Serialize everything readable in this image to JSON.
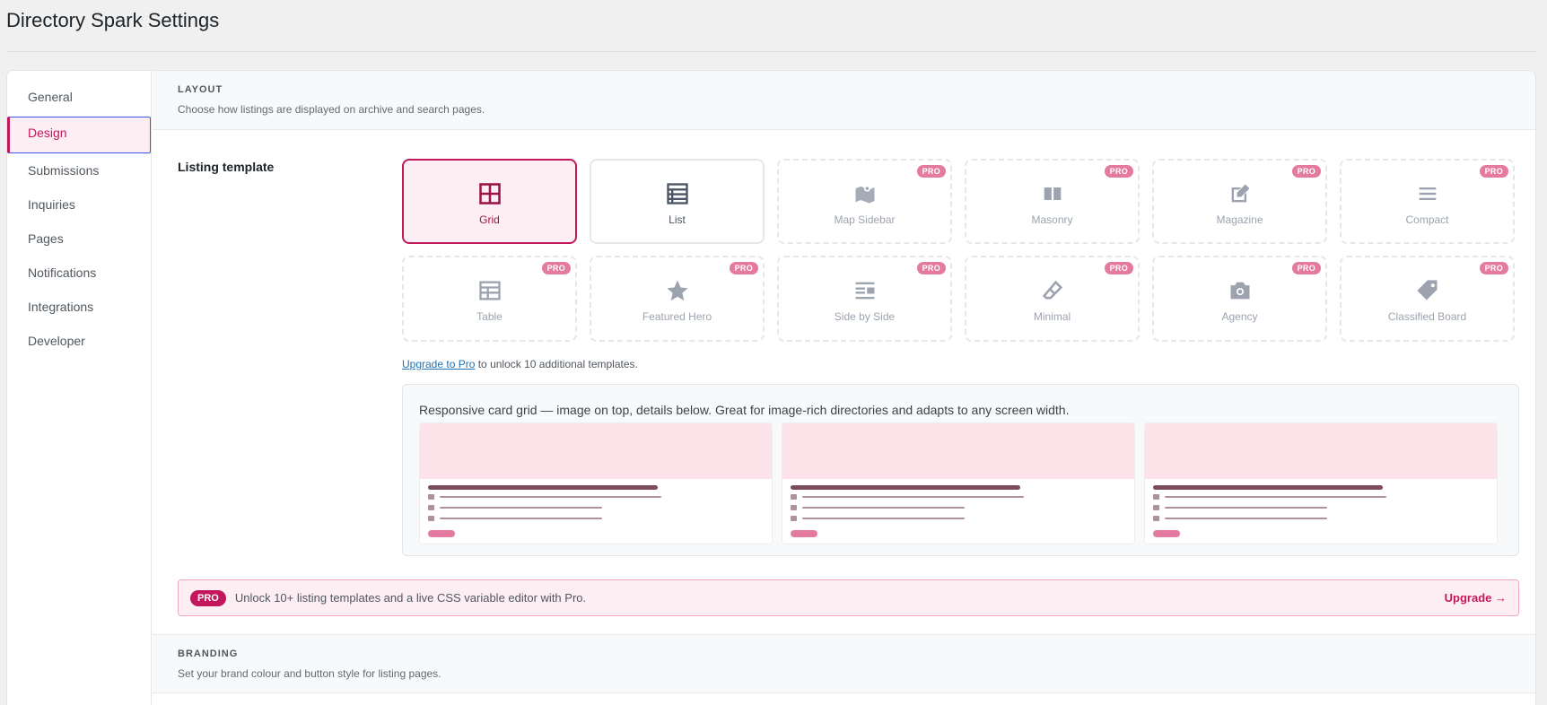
{
  "page": {
    "title": "Directory Spark Settings"
  },
  "sidebar": {
    "items": [
      {
        "label": "General",
        "active": false
      },
      {
        "label": "Design",
        "active": true
      },
      {
        "label": "Submissions",
        "active": false
      },
      {
        "label": "Inquiries",
        "active": false
      },
      {
        "label": "Pages",
        "active": false
      },
      {
        "label": "Notifications",
        "active": false
      },
      {
        "label": "Integrations",
        "active": false
      },
      {
        "label": "Developer",
        "active": false
      }
    ]
  },
  "layout": {
    "title": "LAYOUT",
    "desc": "Choose how listings are displayed on archive and search pages.",
    "listing_label": "Listing template",
    "templates": [
      {
        "label": "Grid",
        "icon": "grid-icon",
        "pro": false,
        "state": "selected"
      },
      {
        "label": "List",
        "icon": "list-icon",
        "pro": false,
        "state": "enabled"
      },
      {
        "label": "Map Sidebar",
        "icon": "map-icon",
        "pro": true,
        "state": "locked"
      },
      {
        "label": "Masonry",
        "icon": "columns-icon",
        "pro": true,
        "state": "locked"
      },
      {
        "label": "Magazine",
        "icon": "edit-icon",
        "pro": true,
        "state": "locked"
      },
      {
        "label": "Compact",
        "icon": "menu-icon",
        "pro": true,
        "state": "locked"
      },
      {
        "label": "Table",
        "icon": "table-icon",
        "pro": true,
        "state": "locked"
      },
      {
        "label": "Featured Hero",
        "icon": "star-icon",
        "pro": true,
        "state": "locked"
      },
      {
        "label": "Side by Side",
        "icon": "align-icon",
        "pro": true,
        "state": "locked"
      },
      {
        "label": "Minimal",
        "icon": "eraser-icon",
        "pro": true,
        "state": "locked"
      },
      {
        "label": "Agency",
        "icon": "camera-icon",
        "pro": true,
        "state": "locked"
      },
      {
        "label": "Classified Board",
        "icon": "tag-icon",
        "pro": true,
        "state": "locked"
      }
    ],
    "pro_label": "PRO",
    "upgrade_link": "Upgrade to Pro",
    "upgrade_rest": " to unlock 10 additional templates.",
    "preview_desc": "Responsive card grid — image on top, details below. Great for image-rich directories and adapts to any screen width."
  },
  "banner": {
    "badge": "PRO",
    "text": "Unlock 10+ listing templates and a live CSS variable editor with Pro.",
    "link": "Upgrade →"
  },
  "branding": {
    "title": "BRANDING",
    "desc": "Set your brand colour and button style for listing pages."
  }
}
